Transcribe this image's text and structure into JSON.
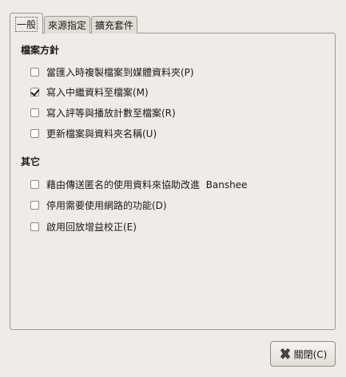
{
  "tabs": [
    {
      "label": "一般",
      "active": true
    },
    {
      "label": "來源指定",
      "active": false
    },
    {
      "label": "擴充套件",
      "active": false
    }
  ],
  "sections": {
    "file_policy": {
      "title": "檔案方針",
      "options": [
        {
          "label": "當匯入時複製檔案到媒體資料夾(P)",
          "checked": false
        },
        {
          "label": "寫入中繼資料至檔案(M)",
          "checked": true
        },
        {
          "label": "寫入評等與播放計數至檔案(R)",
          "checked": false
        },
        {
          "label": "更新檔案與資料夾名稱(U)",
          "checked": false
        }
      ]
    },
    "other": {
      "title": "其它",
      "options": [
        {
          "label": "藉由傳送匿名的使用資料來協助改進  Banshee",
          "checked": false
        },
        {
          "label": "停用需要使用網路的功能(D)",
          "checked": false
        },
        {
          "label": "啟用回放增益校正(E)",
          "checked": false
        }
      ]
    }
  },
  "footer": {
    "close_label": "關閉(C)",
    "close_icon": "close-icon"
  }
}
